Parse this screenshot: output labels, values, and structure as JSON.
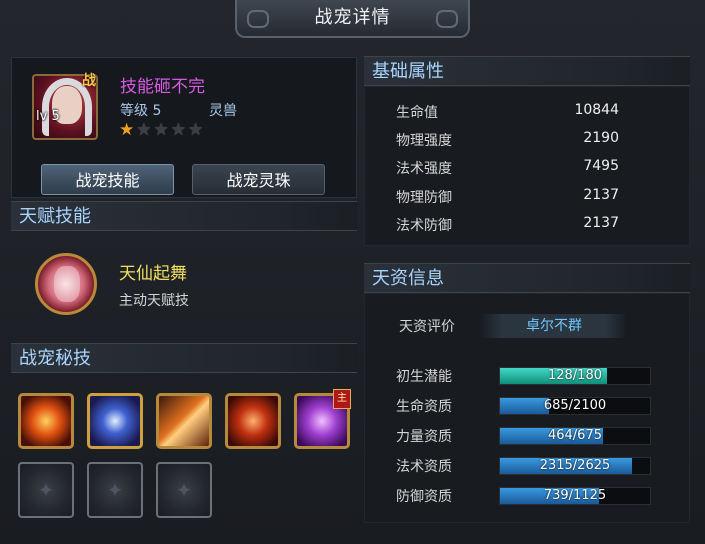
{
  "window": {
    "title": "战宠详情"
  },
  "pet": {
    "badge": "战",
    "level_badge": "lv 5",
    "name": "技能砸不完",
    "level": "等级 5",
    "type": "灵兽",
    "stars": {
      "filled": 1,
      "total": 5
    }
  },
  "buttons": {
    "skill": "战宠技能",
    "pearl": "战宠灵珠"
  },
  "talent": {
    "header": "天赋技能",
    "name": "天仙起舞",
    "type": "主动天赋技"
  },
  "secret": {
    "header": "战宠秘技",
    "badge": "主",
    "skills": [
      "skill-icon-fire-eye",
      "skill-icon-lightning-beast",
      "skill-icon-flame-blade",
      "skill-icon-fire-monk",
      "skill-icon-purple-demon"
    ],
    "empty_slots": 3
  },
  "attributes": {
    "header": "基础属性",
    "rows": [
      {
        "label": "生命值",
        "value": "10844"
      },
      {
        "label": "物理强度",
        "value": "2190"
      },
      {
        "label": "法术强度",
        "value": "7495"
      },
      {
        "label": "物理防御",
        "value": "2137"
      },
      {
        "label": "法术防御",
        "value": "2137"
      }
    ]
  },
  "aptitude": {
    "header": "天资信息",
    "rating_label": "天资评价",
    "rating_value": "卓尔不群",
    "rows": [
      {
        "label": "初生潜能",
        "text": "128/180",
        "current": 128,
        "max": 180,
        "color": "#20b8a8"
      },
      {
        "label": "生命资质",
        "text": "685/2100",
        "current": 685,
        "max": 2100,
        "color": "#2a82d0"
      },
      {
        "label": "力量资质",
        "text": "464/675",
        "current": 464,
        "max": 675,
        "color": "#2a82d0"
      },
      {
        "label": "法术资质",
        "text": "2315/2625",
        "current": 2315,
        "max": 2625,
        "color": "#2a82d0"
      },
      {
        "label": "防御资质",
        "text": "739/1125",
        "current": 739,
        "max": 1125,
        "color": "#2a82d0"
      }
    ]
  }
}
